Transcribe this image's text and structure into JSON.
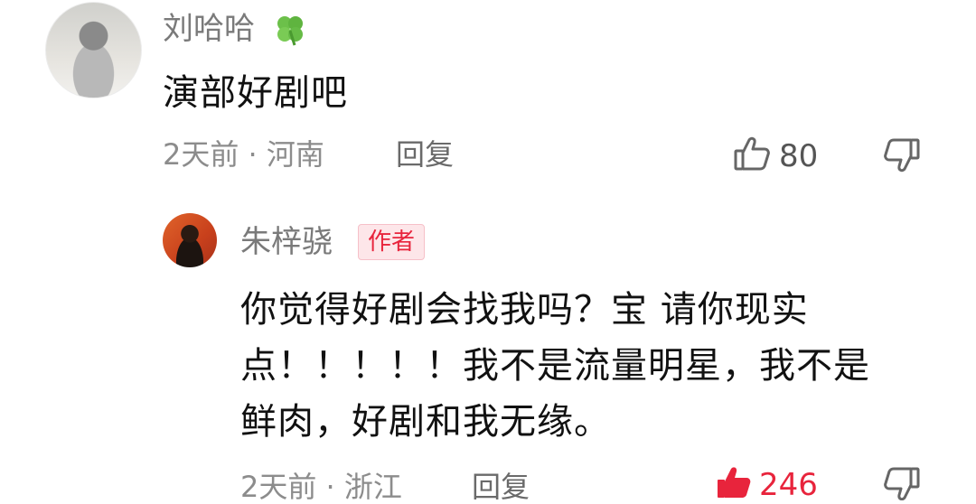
{
  "comment1": {
    "username": "刘哈哈",
    "username_emoji_icon": "clover-icon",
    "text": "演部好剧吧",
    "time": "2天前",
    "separator": "·",
    "location": "河南",
    "reply_label": "回复",
    "like_count": "80"
  },
  "comment2": {
    "username": "朱梓骁",
    "author_badge": "作者",
    "text_line1": "你觉得好剧会找我吗？宝 请你现实",
    "text_line2": "点！！！！！我不是流量明星，我不是",
    "text_line3": "鲜肉，好剧和我无缘。",
    "time": "2天前",
    "separator": "·",
    "location": "浙江",
    "reply_label": "回复",
    "like_count": "246",
    "liked": true
  },
  "colors": {
    "accent_red": "#e8243c",
    "meta_gray": "#8c8c8c",
    "badge_bg": "#fde6e9"
  }
}
